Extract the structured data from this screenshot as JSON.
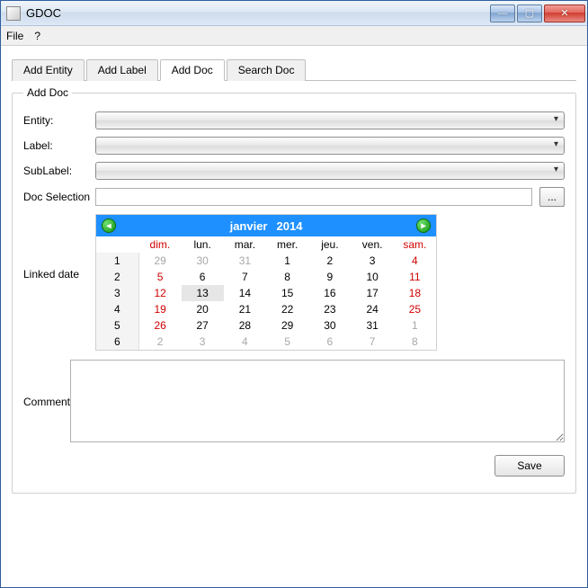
{
  "window": {
    "title": "GDOC"
  },
  "menu": {
    "file": "File",
    "help": "?"
  },
  "tabs": [
    "Add Entity",
    "Add Label",
    "Add Doc",
    "Search Doc"
  ],
  "active_tab": 2,
  "group_title": "Add Doc",
  "fields": {
    "entity": "Entity:",
    "label": "Label:",
    "sublabel": "SubLabel:",
    "docsel": "Doc Selection",
    "linked": "Linked date",
    "comment": "Comment"
  },
  "browse_label": "...",
  "save_label": "Save",
  "calendar": {
    "month": "janvier",
    "year": "2014",
    "day_headers": [
      "",
      "dim.",
      "lun.",
      "mar.",
      "mer.",
      "jeu.",
      "ven.",
      "sam."
    ],
    "rows": [
      {
        "wk": "1",
        "cells": [
          {
            "v": "29",
            "cls": "out"
          },
          {
            "v": "30",
            "cls": "out"
          },
          {
            "v": "31",
            "cls": "out"
          },
          {
            "v": "1",
            "cls": "day"
          },
          {
            "v": "2",
            "cls": "day"
          },
          {
            "v": "3",
            "cls": "day"
          },
          {
            "v": "4",
            "cls": "sat"
          }
        ]
      },
      {
        "wk": "2",
        "cells": [
          {
            "v": "5",
            "cls": "sun"
          },
          {
            "v": "6",
            "cls": "day"
          },
          {
            "v": "7",
            "cls": "day"
          },
          {
            "v": "8",
            "cls": "day"
          },
          {
            "v": "9",
            "cls": "day"
          },
          {
            "v": "10",
            "cls": "day"
          },
          {
            "v": "11",
            "cls": "sat"
          }
        ]
      },
      {
        "wk": "3",
        "cells": [
          {
            "v": "12",
            "cls": "sun"
          },
          {
            "v": "13",
            "cls": "day sel"
          },
          {
            "v": "14",
            "cls": "day"
          },
          {
            "v": "15",
            "cls": "day"
          },
          {
            "v": "16",
            "cls": "day"
          },
          {
            "v": "17",
            "cls": "day"
          },
          {
            "v": "18",
            "cls": "sat"
          }
        ]
      },
      {
        "wk": "4",
        "cells": [
          {
            "v": "19",
            "cls": "sun"
          },
          {
            "v": "20",
            "cls": "day"
          },
          {
            "v": "21",
            "cls": "day"
          },
          {
            "v": "22",
            "cls": "day"
          },
          {
            "v": "23",
            "cls": "day"
          },
          {
            "v": "24",
            "cls": "day"
          },
          {
            "v": "25",
            "cls": "sat"
          }
        ]
      },
      {
        "wk": "5",
        "cells": [
          {
            "v": "26",
            "cls": "sun"
          },
          {
            "v": "27",
            "cls": "day"
          },
          {
            "v": "28",
            "cls": "day"
          },
          {
            "v": "29",
            "cls": "day"
          },
          {
            "v": "30",
            "cls": "day"
          },
          {
            "v": "31",
            "cls": "day"
          },
          {
            "v": "1",
            "cls": "out"
          }
        ]
      },
      {
        "wk": "6",
        "cells": [
          {
            "v": "2",
            "cls": "out"
          },
          {
            "v": "3",
            "cls": "out"
          },
          {
            "v": "4",
            "cls": "out"
          },
          {
            "v": "5",
            "cls": "out"
          },
          {
            "v": "6",
            "cls": "out"
          },
          {
            "v": "7",
            "cls": "out"
          },
          {
            "v": "8",
            "cls": "out"
          }
        ]
      }
    ]
  }
}
